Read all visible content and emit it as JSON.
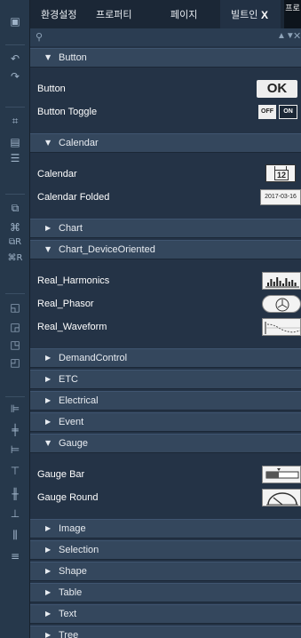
{
  "tabs": [
    {
      "label": "환경설정",
      "active": false
    },
    {
      "label": "프로퍼티",
      "active": false
    },
    {
      "label": "페이지",
      "active": false
    },
    {
      "label": "빌트인",
      "active": true
    }
  ],
  "close_label": "X",
  "tab_edge_label": "프로",
  "search": {
    "placeholder": "",
    "value": "",
    "icon": "search-icon"
  },
  "groups": [
    {
      "label": "Button",
      "expanded": true,
      "items": [
        {
          "label": "Button",
          "preview": "ok-button",
          "preview_text": "OK"
        },
        {
          "label": "Button Toggle",
          "preview": "toggle-button",
          "off_text": "OFF",
          "on_text": "ON"
        }
      ]
    },
    {
      "label": "Calendar",
      "expanded": true,
      "items": [
        {
          "label": "Calendar",
          "preview": "calendar",
          "preview_text": "12"
        },
        {
          "label": "Calendar Folded",
          "preview": "calendar-folded",
          "preview_text": "2017-03-16"
        }
      ]
    },
    {
      "label": "Chart",
      "expanded": false,
      "items": []
    },
    {
      "label": "Chart_DeviceOriented",
      "expanded": true,
      "items": [
        {
          "label": "Real_Harmonics",
          "preview": "harmonics"
        },
        {
          "label": "Real_Phasor",
          "preview": "phasor"
        },
        {
          "label": "Real_Waveform",
          "preview": "waveform"
        }
      ]
    },
    {
      "label": "DemandControl",
      "expanded": false,
      "items": []
    },
    {
      "label": "ETC",
      "expanded": false,
      "items": []
    },
    {
      "label": "Electrical",
      "expanded": false,
      "items": []
    },
    {
      "label": "Event",
      "expanded": false,
      "items": []
    },
    {
      "label": "Gauge",
      "expanded": true,
      "items": [
        {
          "label": "Gauge Bar",
          "preview": "gauge-bar"
        },
        {
          "label": "Gauge Round",
          "preview": "gauge-round"
        }
      ]
    },
    {
      "label": "Image",
      "expanded": false,
      "items": []
    },
    {
      "label": "Selection",
      "expanded": false,
      "items": []
    },
    {
      "label": "Shape",
      "expanded": false,
      "items": []
    },
    {
      "label": "Table",
      "expanded": false,
      "items": []
    },
    {
      "label": "Text",
      "expanded": false,
      "items": []
    },
    {
      "label": "Tree",
      "expanded": false,
      "items": []
    }
  ],
  "toolbar": [
    {
      "name": "save-icon",
      "glyph": "▣"
    },
    {
      "name": "undo-icon",
      "glyph": "↶"
    },
    {
      "name": "redo-icon",
      "glyph": "↷"
    },
    {
      "name": "crop-icon",
      "glyph": "⌗"
    },
    {
      "name": "page-icon",
      "glyph": "▤"
    },
    {
      "name": "page-list-icon",
      "glyph": "☰"
    },
    {
      "name": "group-icon",
      "glyph": "⧉"
    },
    {
      "name": "ungroup-icon",
      "glyph": "⌘"
    },
    {
      "name": "group-r-icon",
      "glyph": "⧉R"
    },
    {
      "name": "ungroup-r-icon",
      "glyph": "⌘R"
    },
    {
      "name": "bring-forward-icon",
      "glyph": "◱"
    },
    {
      "name": "send-backward-icon",
      "glyph": "◲"
    },
    {
      "name": "bring-front-icon",
      "glyph": "◳"
    },
    {
      "name": "send-back-icon",
      "glyph": "◰"
    },
    {
      "name": "align-left-icon",
      "glyph": "⊫"
    },
    {
      "name": "align-center-icon",
      "glyph": "╪"
    },
    {
      "name": "align-right-icon",
      "glyph": "⊨"
    },
    {
      "name": "align-top-icon",
      "glyph": "⊤"
    },
    {
      "name": "align-middle-icon",
      "glyph": "╫"
    },
    {
      "name": "align-bottom-icon",
      "glyph": "⊥"
    },
    {
      "name": "distribute-h-icon",
      "glyph": "⫼"
    },
    {
      "name": "distribute-v-icon",
      "glyph": "≡"
    }
  ]
}
